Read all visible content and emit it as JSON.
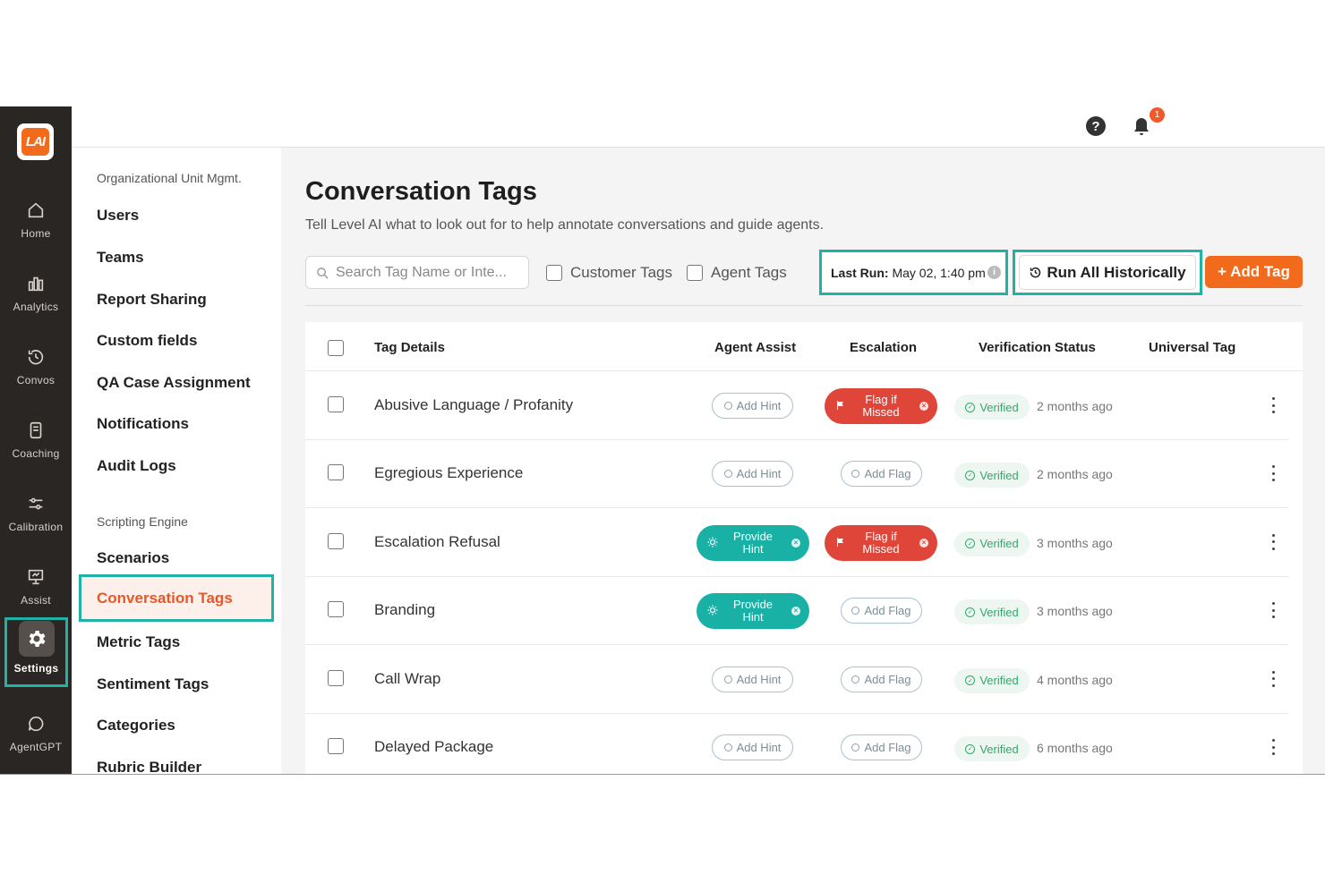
{
  "rail": {
    "logo": "LAI",
    "items": [
      {
        "label": "Home",
        "icon": "home-icon"
      },
      {
        "label": "Analytics",
        "icon": "bar-chart-icon"
      },
      {
        "label": "Convos",
        "icon": "history-icon"
      },
      {
        "label": "Coaching",
        "icon": "document-icon"
      },
      {
        "label": "Calibration",
        "icon": "sliders-icon"
      },
      {
        "label": "Assist",
        "icon": "presentation-icon"
      },
      {
        "label": "Settings",
        "icon": "gear-icon"
      },
      {
        "label": "AgentGPT",
        "icon": "chat-bubble-icon"
      }
    ]
  },
  "header": {
    "help_icon": "?",
    "notification_count": "1"
  },
  "subnav": {
    "section1_title": "Organizational Unit Mgmt.",
    "section1_items": [
      "Users",
      "Teams",
      "Report Sharing",
      "Custom fields",
      "QA Case Assignment",
      "Notifications",
      "Audit Logs"
    ],
    "section2_title": "Scripting Engine",
    "section2_items": [
      "Scenarios",
      "Conversation Tags",
      "Metric Tags",
      "Sentiment Tags",
      "Categories",
      "Rubric Builder"
    ]
  },
  "main": {
    "title": "Conversation Tags",
    "description": "Tell Level AI what to look out for to help annotate conversations and guide agents.",
    "search_placeholder": "Search Tag Name or Inte...",
    "filter_customer": "Customer Tags",
    "filter_agent": "Agent Tags",
    "last_run_label": "Last Run:",
    "last_run_value": "May 02, 1:40 pm",
    "run_all_label": "Run All Historically",
    "add_tag_label": "+ Add Tag"
  },
  "table": {
    "columns": [
      "Tag Details",
      "Agent Assist",
      "Escalation",
      "Verification Status",
      "Universal Tag"
    ],
    "rows": [
      {
        "name": "Abusive Language / Profanity",
        "agent_assist": "Add Hint",
        "agent_assist_active": false,
        "escalation": "Flag if Missed",
        "escalation_active": true,
        "status": "Verified",
        "ago": "2 months ago"
      },
      {
        "name": "Egregious Experience",
        "agent_assist": "Add Hint",
        "agent_assist_active": false,
        "escalation": "Add Flag",
        "escalation_active": false,
        "status": "Verified",
        "ago": "2 months ago"
      },
      {
        "name": "Escalation Refusal",
        "agent_assist": "Provide Hint",
        "agent_assist_active": true,
        "escalation": "Flag if Missed",
        "escalation_active": true,
        "status": "Verified",
        "ago": "3 months ago"
      },
      {
        "name": "Branding",
        "agent_assist": "Provide Hint",
        "agent_assist_active": true,
        "escalation": "Add Flag",
        "escalation_active": false,
        "status": "Verified",
        "ago": "3 months ago"
      },
      {
        "name": "Call Wrap",
        "agent_assist": "Add Hint",
        "agent_assist_active": false,
        "escalation": "Add Flag",
        "escalation_active": false,
        "status": "Verified",
        "ago": "4 months ago"
      },
      {
        "name": "Delayed Package",
        "agent_assist": "Add Hint",
        "agent_assist_active": false,
        "escalation": "Add Flag",
        "escalation_active": false,
        "status": "Verified",
        "ago": "6 months ago"
      }
    ]
  },
  "colors": {
    "brand_orange": "#f26a1b",
    "highlight_teal": "#1fb3a6",
    "flag_red": "#df4539",
    "verified_green": "#33a86a"
  }
}
